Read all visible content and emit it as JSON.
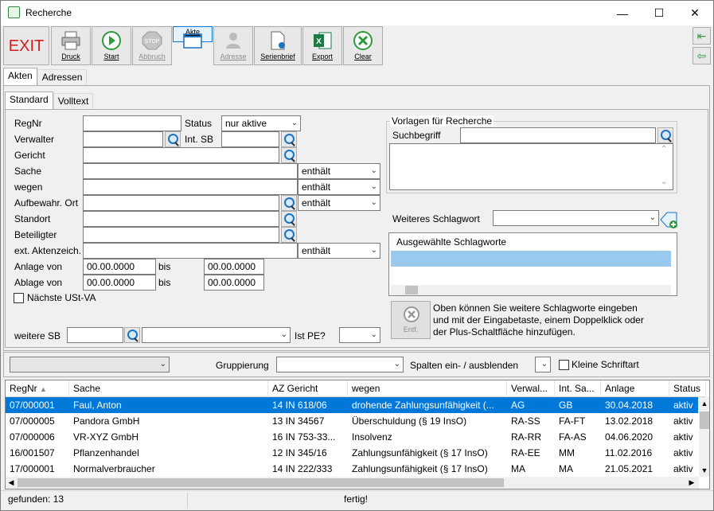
{
  "window": {
    "title": "Recherche"
  },
  "toolbar": {
    "exit": "EXIT",
    "druck": "Druck",
    "start": "Start",
    "abbruch": "Abbruch",
    "akte": "Akte",
    "adresse": "Adresse",
    "serienbrief": "Serienbrief",
    "export": "Export",
    "clear": "Clear"
  },
  "tabs": {
    "main": [
      "Akten",
      "Adressen"
    ],
    "sub": [
      "Standard",
      "Volltext"
    ]
  },
  "form": {
    "regnr": "RegNr",
    "status": "Status",
    "status_value": "nur aktive",
    "verwalter": "Verwalter",
    "int_sb": "Int. SB",
    "gericht": "Gericht",
    "sache": "Sache",
    "sache_mode": "enthält",
    "wegen": "wegen",
    "wegen_mode": "enthält",
    "aufbewahr": "Aufbewahr. Ort",
    "aufbewahr_mode": "enthält",
    "standort": "Standort",
    "beteiligter": "Beteiligter",
    "ext_az": "ext. Aktenzeich.",
    "ext_az_mode": "enthält",
    "anlage_von": "Anlage von",
    "anlage_von_value": "00.00.0000",
    "anlage_bis": "bis",
    "anlage_bis_value": "00.00.0000",
    "ablage_von": "Ablage von",
    "ablage_von_value": "00.00.0000",
    "ablage_bis": "bis",
    "ablage_bis_value": "00.00.0000",
    "naechste_ust": "Nächste USt-VA",
    "weitere_sb": "weitere SB",
    "ist_pe": "Ist PE?"
  },
  "vorlagen": {
    "title": "Vorlagen für Recherche",
    "suchbegriff": "Suchbegriff"
  },
  "schlagwort": {
    "label": "Weiteres Schlagwort",
    "list_header": "Ausgewählte Schlagworte",
    "entf": "Entf.",
    "hint": [
      "Oben können Sie weitere Schlagworte eingeben",
      "und mit der Eingabetaste, einem Doppelklick oder",
      "der Plus-Schaltfläche hinzufügen."
    ]
  },
  "groupbar": {
    "gruppierung": "Gruppierung",
    "spalten": "Spalten ein- / ausblenden",
    "kleine": "Kleine Schriftart"
  },
  "grid": {
    "columns": [
      "RegNr",
      "Sache",
      "AZ Gericht",
      "wegen",
      "Verwal...",
      "Int. Sa...",
      "Anlage",
      "Status"
    ],
    "rows": [
      [
        "07/000001",
        "Faul, Anton",
        "14 IN 618/06",
        "drohende Zahlungsunfähigkeit (...",
        "AG",
        "GB",
        "30.04.2018",
        "aktiv"
      ],
      [
        "07/000005",
        "Pandora GmbH",
        "13 IN 34567",
        "Überschuldung (§ 19 InsO)",
        "RA-SS",
        "FA-FT",
        "13.02.2018",
        "aktiv"
      ],
      [
        "07/000006",
        "VR-XYZ GmbH",
        "16 IN 753-33...",
        "Insolvenz",
        "RA-RR",
        "FA-AS",
        "04.06.2020",
        "aktiv"
      ],
      [
        "16/001507",
        "Pflanzenhandel",
        "12 IN 345/16",
        "Zahlungsunfähigkeit (§ 17 InsO)",
        "RA-EE",
        "MM",
        "11.02.2016",
        "aktiv"
      ],
      [
        "17/000001",
        "Normalverbraucher",
        "14 IN 222/333",
        "Zahlungsunfähigkeit (§ 17 InsO)",
        "MA",
        "MA",
        "21.05.2021",
        "aktiv"
      ]
    ]
  },
  "status": {
    "found": "gefunden: 13",
    "state": "fertig!"
  }
}
